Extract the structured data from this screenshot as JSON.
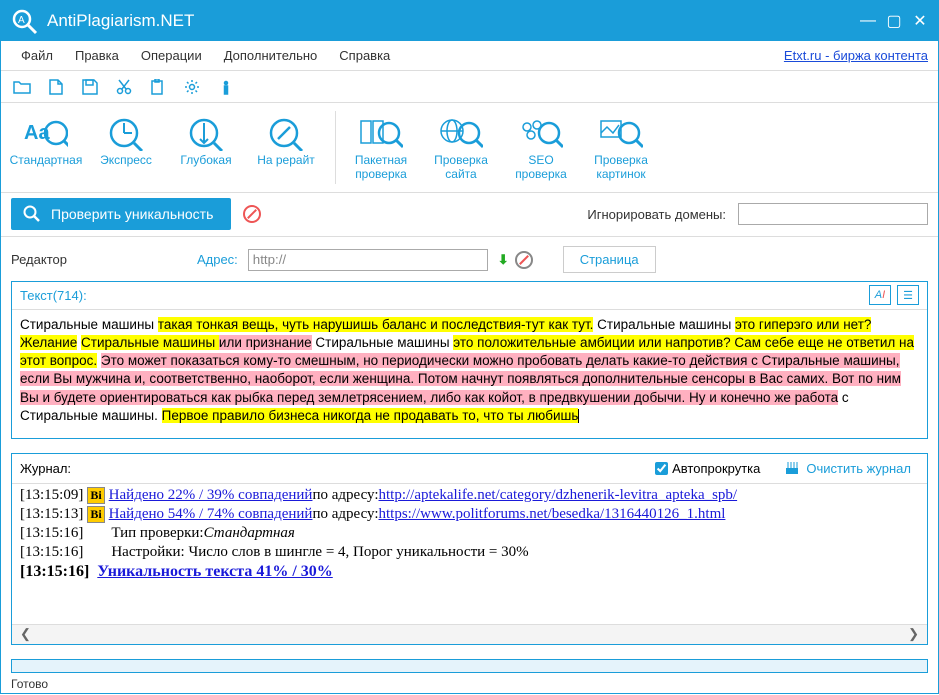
{
  "app": {
    "title": "AntiPlagiarism.NET"
  },
  "menubar": {
    "items": [
      "Файл",
      "Правка",
      "Операции",
      "Дополнительно",
      "Справка"
    ],
    "external": "Etxt.ru - биржа контента"
  },
  "toolbar_big": {
    "group1": [
      {
        "label": "Стандартная"
      },
      {
        "label": "Экспресс"
      },
      {
        "label": "Глубокая"
      },
      {
        "label": "На рерайт"
      }
    ],
    "group2": [
      {
        "label": "Пакетная проверка"
      },
      {
        "label": "Проверка сайта"
      },
      {
        "label": "SEO проверка"
      },
      {
        "label": "Проверка картинок"
      }
    ]
  },
  "action": {
    "check_label": "Проверить уникальность",
    "ignore_label": "Игнорировать домены:",
    "ignore_value": ""
  },
  "editor": {
    "title": "Редактор",
    "addr_label": "Адрес:",
    "addr_value": "http://",
    "tab_label": "Страница",
    "text_count": "Текст(714):"
  },
  "text": {
    "p1a": "Стиральные машины ",
    "p1b": "такая тонкая вещь, чуть нарушишь баланс и последствия-тут как тут.",
    "p1c": " Стиральные машины ",
    "p1d": "это гиперэго или нет? Желание",
    "p2a": "Стиральные машины ",
    "p2b": "или признание",
    "p2c": " Стиральные машины ",
    "p2d": "это положительные амбиции или напротив? Сам себе еще не ответил на этот вопрос.",
    "p3": "Это может показаться кому-то смешным, но периодически можно пробовать делать какие-то действия с Стиральные машины, если Вы мужчина и, соответственно, наоборот, если женщина. Потом начнут появляться дополнительные сенсоры в Вас самих. Вот по ним Вы и будете ориентироваться как рыбка перед землетрясением, либо как койот, в предвкушении добычи. Ну и конечно же работа",
    "p3b": " с Стиральные машины.",
    "p4": "Первое правило бизнеса никогда не продавать то, что ты любишь"
  },
  "journal": {
    "title": "Журнал:",
    "autoscroll": "Автопрокрутка",
    "clear": "Очистить журнал",
    "rows": [
      {
        "time": "[13:15:09]",
        "badge": "Bi",
        "link": "Найдено 22% / 39% совпадений",
        "mid": " по адресу: ",
        "url": "http://aptekalife.net/category/dzhenerik-levitra_apteka_spb/"
      },
      {
        "time": "[13:15:13]",
        "badge": "Bi",
        "link": "Найдено 54% / 74% совпадений",
        "mid": " по адресу: ",
        "url": "https://www.politforums.net/besedka/1316440126_1.html"
      },
      {
        "time": "[13:15:16]",
        "plain": "Тип проверки: ",
        "italic": "Стандартная"
      },
      {
        "time": "[13:15:16]",
        "plain": "Настройки: Число слов в шингле = 4, Порог уникальности = 30%"
      },
      {
        "time": "[13:15:16]",
        "boldlink": "Уникальность текста 41% / 30%"
      }
    ]
  },
  "status": {
    "text": "Готово"
  }
}
